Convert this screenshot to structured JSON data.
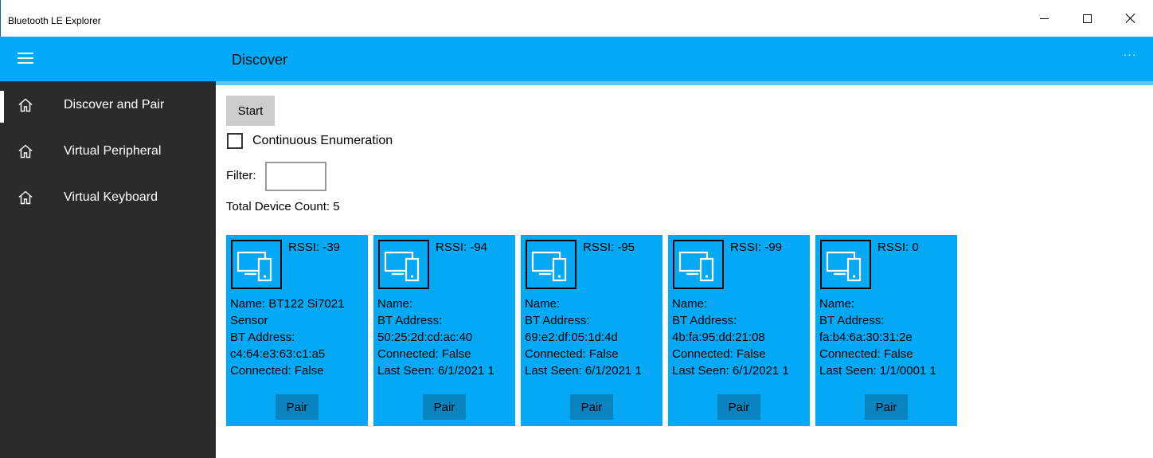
{
  "window": {
    "title": "Bluetooth LE Explorer"
  },
  "header": {
    "page_title": "Discover",
    "more_label": "···"
  },
  "sidebar": {
    "items": [
      {
        "label": "Discover and Pair",
        "icon": "home-icon",
        "selected": true
      },
      {
        "label": "Virtual Peripheral",
        "icon": "home-icon",
        "selected": false
      },
      {
        "label": "Virtual Keyboard",
        "icon": "home-icon",
        "selected": false
      }
    ]
  },
  "main": {
    "start_label": "Start",
    "continuous_label": "Continuous Enumeration",
    "continuous_checked": false,
    "filter_label": "Filter:",
    "filter_value": "",
    "device_count": "Total Device Count: 5"
  },
  "devices": [
    {
      "rssi": "RSSI: -39",
      "lines": [
        "Name: BT122 Si7021 Sensor",
        "BT Address:",
        "c4:64:e3:63:c1:a5",
        "Connected: False"
      ],
      "pair_label": "Pair"
    },
    {
      "rssi": "RSSI: -94",
      "lines": [
        "Name:",
        "BT Address:",
        "50:25:2d:cd:ac:40",
        "Connected: False",
        "Last Seen: 6/1/2021 1"
      ],
      "pair_label": "Pair"
    },
    {
      "rssi": "RSSI: -95",
      "lines": [
        "Name:",
        "BT Address:",
        "69:e2:df:05:1d:4d",
        "Connected: False",
        "Last Seen: 6/1/2021 1"
      ],
      "pair_label": "Pair"
    },
    {
      "rssi": "RSSI: -99",
      "lines": [
        "Name:",
        "BT Address:",
        "4b:fa:95:dd:21:08",
        "Connected: False",
        "Last Seen: 6/1/2021 1"
      ],
      "pair_label": "Pair"
    },
    {
      "rssi": "RSSI: 0",
      "lines": [
        "Name:",
        "BT Address:",
        "fa:b4:6a:30:31:2e",
        "Connected: False",
        "Last Seen: 1/1/0001 1"
      ],
      "pair_label": "Pair"
    }
  ],
  "colors": {
    "accent": "#03a9f4",
    "sidebar_bg": "#2b2b2b",
    "pair_button": "#0984c0"
  }
}
